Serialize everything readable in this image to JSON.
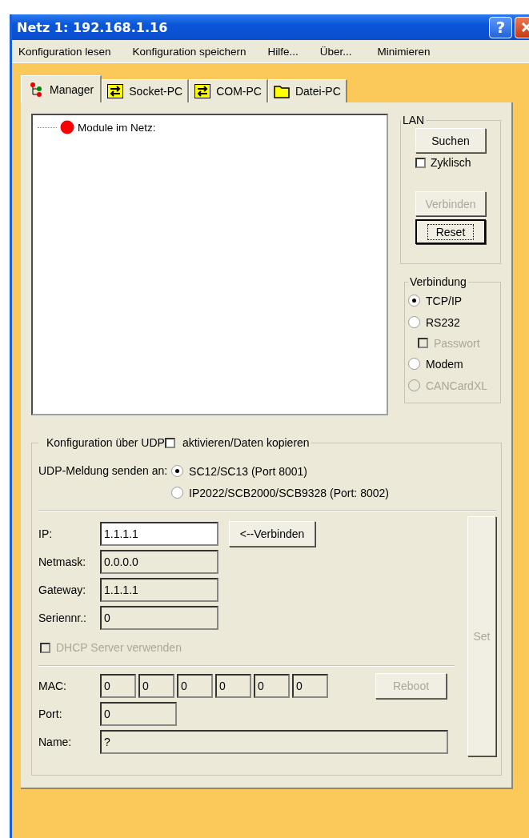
{
  "window": {
    "title": "Netz 1: 192.168.1.16",
    "help_button": "?"
  },
  "menu": [
    "Konfiguration lesen",
    "Konfiguration speichern",
    "Hilfe...",
    "Über...",
    "Minimieren"
  ],
  "tabs": [
    {
      "label": "Manager",
      "kind": "manager",
      "selected": true
    },
    {
      "label": "Socket-PC",
      "kind": "transfer",
      "selected": false
    },
    {
      "label": "COM-PC",
      "kind": "transfer",
      "selected": false
    },
    {
      "label": "Datei-PC",
      "kind": "folder",
      "selected": false
    }
  ],
  "tree": {
    "items": [
      {
        "label": "Module im Netz:"
      }
    ]
  },
  "lan": {
    "title": "LAN",
    "search_button": {
      "label": "Suchen",
      "disabled": false
    },
    "cyclic": {
      "label": "Zyklisch",
      "checked": false,
      "disabled": false
    },
    "connect_button": {
      "label": "Verbinden",
      "disabled": true
    },
    "reset_button": {
      "label": "Reset",
      "disabled": false,
      "focused": true
    }
  },
  "connection": {
    "title": "Verbindung",
    "options": [
      {
        "kind": "radio",
        "label": "TCP/IP",
        "selected": true,
        "disabled": false
      },
      {
        "kind": "radio",
        "label": "RS232",
        "selected": false,
        "disabled": false
      },
      {
        "kind": "checkbox",
        "label": "Passwort",
        "checked": false,
        "disabled": true
      },
      {
        "kind": "radio",
        "label": "Modem",
        "selected": false,
        "disabled": false
      },
      {
        "kind": "radio",
        "label": "CANCardXL",
        "selected": false,
        "disabled": true
      }
    ]
  },
  "udp": {
    "title": "Konfiguration über UDP",
    "activate": {
      "label": "aktivieren/Daten kopieren",
      "checked": false
    },
    "send_label": "UDP-Meldung senden an:",
    "targets": [
      {
        "label": "SC12/SC13 (Port 8001)",
        "selected": true
      },
      {
        "label": "IP2022/SCB2000/SCB9328 (Port: 8002)",
        "selected": false
      }
    ],
    "fields": [
      {
        "label": "IP:",
        "value": "1.1.1.1",
        "disabled": false
      },
      {
        "label": "Netmask:",
        "value": "0.0.0.0",
        "disabled": true
      },
      {
        "label": "Gateway:",
        "value": "1.1.1.1",
        "disabled": true
      },
      {
        "label": "Seriennr.:",
        "value": "0",
        "disabled": true
      }
    ],
    "connect_button": {
      "label": "<--Verbinden",
      "disabled": false
    },
    "dhcp": {
      "label": "DHCP Server verwenden",
      "checked": false,
      "disabled": true
    },
    "mac": {
      "label": "MAC:",
      "values": [
        "0",
        "0",
        "0",
        "0",
        "0",
        "0"
      ],
      "disabled": true
    },
    "reboot_button": {
      "label": "Reboot",
      "disabled": true
    },
    "port": {
      "label": "Port:",
      "value": "0",
      "disabled": true
    },
    "name": {
      "label": "Name:",
      "value": "?",
      "disabled": true
    },
    "set_button": {
      "label": "Set",
      "disabled": true
    }
  }
}
